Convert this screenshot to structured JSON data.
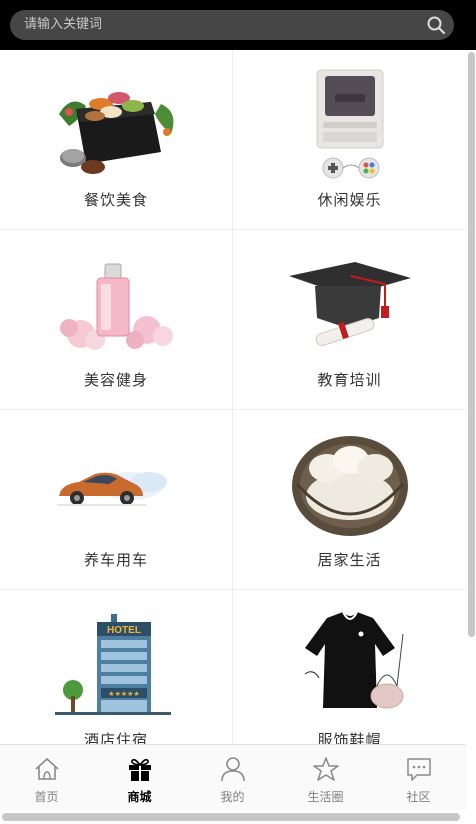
{
  "search": {
    "placeholder": "请输入关键词",
    "icon": "search-icon"
  },
  "categories": [
    {
      "label": "餐饮美食",
      "icon": "food-icon"
    },
    {
      "label": "休闲娱乐",
      "icon": "game-console-icon"
    },
    {
      "label": "美容健身",
      "icon": "perfume-icon"
    },
    {
      "label": "教育培训",
      "icon": "graduation-cap-icon"
    },
    {
      "label": "养车用车",
      "icon": "car-icon"
    },
    {
      "label": "居家生活",
      "icon": "chair-icon"
    },
    {
      "label": "酒店住宿",
      "icon": "hotel-icon",
      "sign": "HOTEL",
      "stars": "★★★★★"
    },
    {
      "label": "服饰鞋帽",
      "icon": "clothing-icon"
    }
  ],
  "tabbar": [
    {
      "label": "首页",
      "icon": "home-icon"
    },
    {
      "label": "商城",
      "icon": "gift-icon",
      "active": true
    },
    {
      "label": "我的",
      "icon": "user-icon"
    },
    {
      "label": "生活圈",
      "icon": "star-icon"
    },
    {
      "label": "社区",
      "icon": "chat-icon"
    }
  ],
  "colors": {
    "topbar": "#000000",
    "search_bg": "#464646",
    "active_tab": "#000000",
    "inactive_tab": "#808080"
  }
}
